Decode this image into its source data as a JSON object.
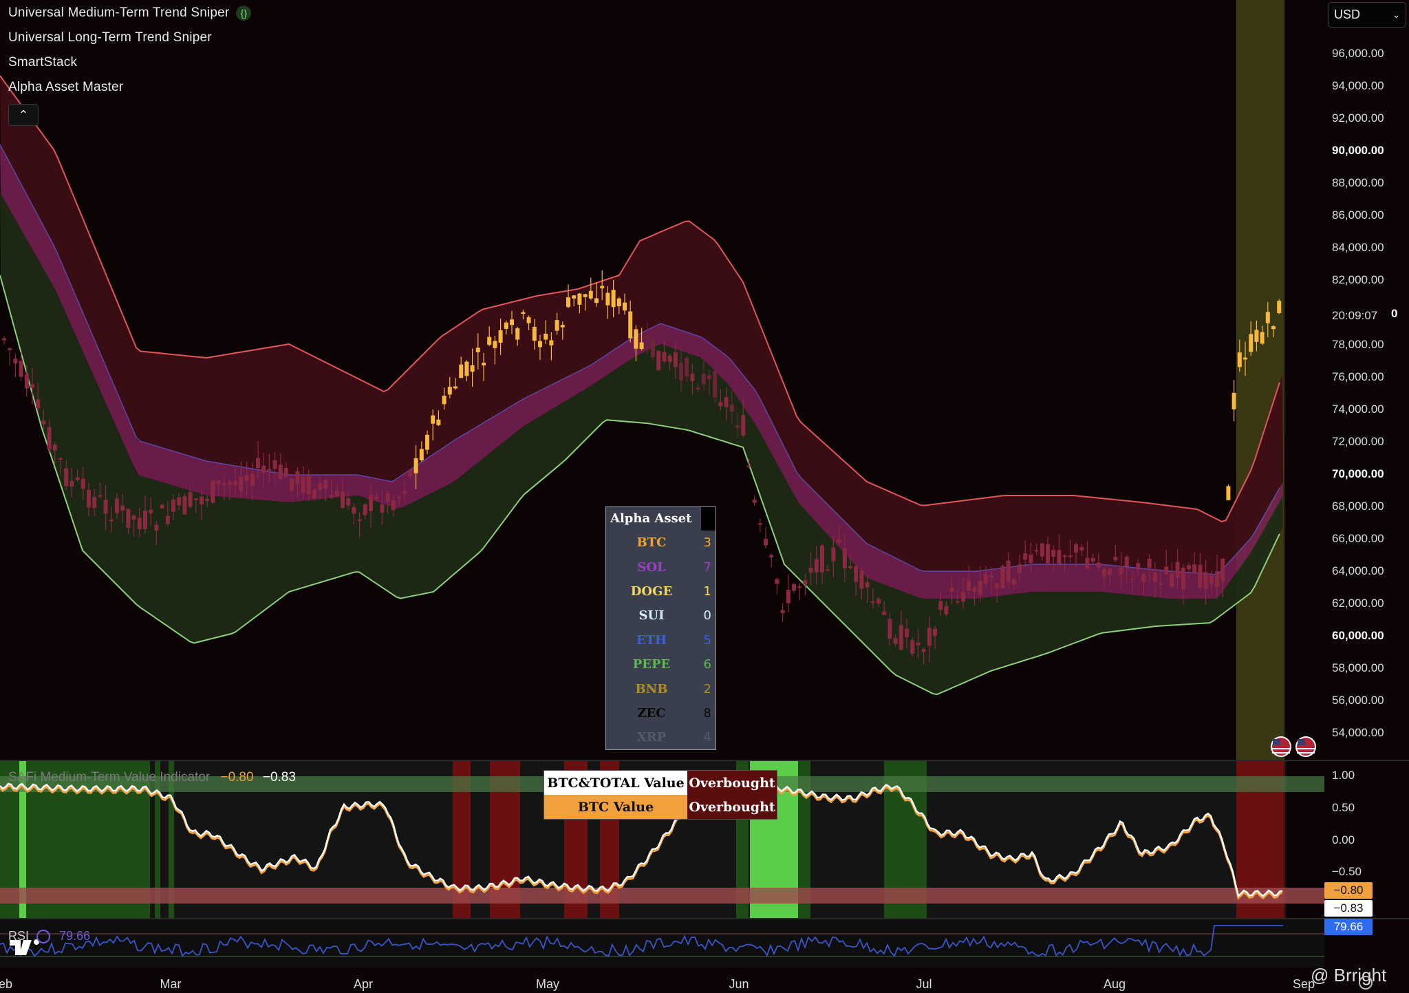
{
  "indicators": [
    "Universal Medium-Term Trend Sniper",
    "Universal Long-Term Trend Sniper",
    "SmartStack",
    "Alpha Asset Master"
  ],
  "indicator_brace_icon": "{}",
  "collapse_icon": "chevron-up-icon",
  "currency": "USD",
  "price_axis": {
    "labels": [
      "96,000.00",
      "94,000.00",
      "92,000.00",
      "90,000.00",
      "88,000.00",
      "86,000.00",
      "84,000.00",
      "82,000.00",
      "78,000.00",
      "76,000.00",
      "74,000.00",
      "72,000.00",
      "70,000.00",
      "68,000.00",
      "66,000.00",
      "64,000.00",
      "62,000.00",
      "60,000.00",
      "58,000.00",
      "56,000.00",
      "54,000.00"
    ],
    "countdown": "20:09:07",
    "countdown_suffix": "0"
  },
  "month_axis": [
    "eb",
    "Mar",
    "Apr",
    "May",
    "Jun",
    "Jul",
    "Aug",
    "Sep"
  ],
  "alpha_asset": {
    "title": "Alpha Asset",
    "rows": [
      {
        "name": "BTC",
        "value": "3",
        "color": "#f0a436"
      },
      {
        "name": "SOL",
        "value": "7",
        "color": "#9b3fc4"
      },
      {
        "name": "DOGE",
        "value": "1",
        "color": "#f5d866"
      },
      {
        "name": "SUI",
        "value": "0",
        "color": "#d8ecf7"
      },
      {
        "name": "ETH",
        "value": "5",
        "color": "#3a5ee0"
      },
      {
        "name": "PEPE",
        "value": "6",
        "color": "#5db84f"
      },
      {
        "name": "BNB",
        "value": "2",
        "color": "#b08d1f"
      },
      {
        "name": "ZEC",
        "value": "8",
        "color": "#0a0a0a"
      },
      {
        "name": "XRP",
        "value": "4",
        "color": "#555b66"
      }
    ]
  },
  "value_pane": {
    "title": "SAFi Medium-Term Value Indicator",
    "value1": "−0.80",
    "value2": "−0.83",
    "axis": [
      "1.00",
      "0.50",
      "0.00",
      "−0.50"
    ],
    "tag1": "−0.80",
    "tag2": "−0.83",
    "status": [
      {
        "label": "BTC&TOTAL Value",
        "state": "Overbought"
      },
      {
        "label": "BTC Value",
        "state": "Overbought"
      }
    ]
  },
  "rsi": {
    "label": "RSI",
    "value": "79.66",
    "tag": "79.66"
  },
  "watermark": "@ Brright",
  "colors": {
    "candle_up": "#f6b93b",
    "candle_down": "#8b2942",
    "band_upper": "#e0565b",
    "band_lower": "#8fcf7d",
    "value_line": "#ffffff",
    "value_line2": "#f0a03c",
    "tag_orange": "#f0a03c",
    "tag_blue": "#2e6cf0",
    "overbought_bg": "#5a0d0d"
  }
}
